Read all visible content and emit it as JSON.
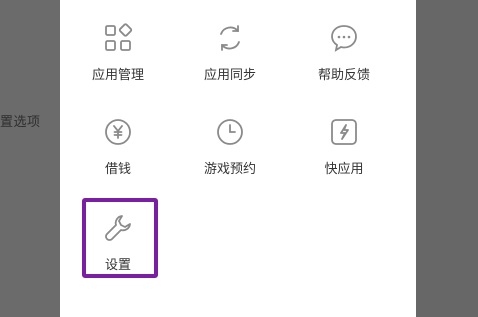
{
  "background": {
    "left_text": "置选项",
    "top_text": "",
    "dim_color": "#666666"
  },
  "grid": {
    "items": [
      {
        "label": "应用管理",
        "icon": "apps-grid-icon"
      },
      {
        "label": "应用同步",
        "icon": "sync-icon"
      },
      {
        "label": "帮助反馈",
        "icon": "chat-bubble-icon"
      },
      {
        "label": "借钱",
        "icon": "yen-coin-icon"
      },
      {
        "label": "游戏预约",
        "icon": "clock-icon"
      },
      {
        "label": "快应用",
        "icon": "quick-app-icon"
      },
      {
        "label": "设置",
        "icon": "wrench-icon"
      }
    ]
  },
  "highlight": {
    "target": "设置",
    "color": "#7b1fa2"
  }
}
